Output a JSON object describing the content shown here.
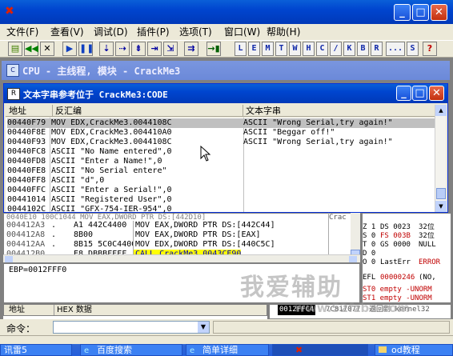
{
  "window": {
    "title_icon": "x-bug-icon"
  },
  "menu": [
    "文件(F)",
    "查看(V)",
    "调试(D)",
    "插件(P)",
    "选项(T)",
    "窗口(W)",
    "帮助(H)"
  ],
  "toolbar_letters": [
    "L",
    "E",
    "M",
    "T",
    "W",
    "H",
    "C",
    "/",
    "K",
    "B",
    "R",
    "...",
    "S"
  ],
  "cpu": {
    "title": "CPU - 主线程, 模块 - CrackMe3"
  },
  "strings_window": {
    "title": "文本字串参考位于 CrackMe3:CODE",
    "headers": [
      "地址",
      "反汇编",
      "文本字串"
    ],
    "rows": [
      [
        "00440F79",
        "MOV EDX,CrackMe3.0044108C",
        "ASCII \"Wrong Serial,try again!\""
      ],
      [
        "00440F8E",
        "MOV EDX,CrackMe3.004410A0",
        "ASCII \"Beggar off!\""
      ],
      [
        "00440F93",
        "MOV EDX,CrackMe3.0044108C",
        "ASCII \"Wrong Serial,try again!\""
      ],
      [
        "00440FC8",
        "ASCII \"No Name entered\",0",
        ""
      ],
      [
        "00440FD8",
        "ASCII \"Enter a Name!\",0",
        ""
      ],
      [
        "00440FE8",
        "ASCII \"No Serial entere\"",
        ""
      ],
      [
        "00440FF8",
        "ASCII \"d\",0",
        ""
      ],
      [
        "00440FFC",
        "ASCII \"Enter a Serial!\",0",
        ""
      ],
      [
        "00441014",
        "ASCII \"Registered User\",0",
        ""
      ],
      [
        "0044102C",
        "ASCII \"GFX-754-IER-954\",0",
        ""
      ]
    ]
  },
  "disasm": {
    "partial_top": "0040E10  100C1044  MOV EAX,DWORD PTR DS:[442D10]",
    "rows": [
      [
        "004412A3",
        ".",
        "A1 442C4400",
        "MOV EAX,DWORD PTR DS:[442C44]"
      ],
      [
        "004412A8",
        ".",
        "8B00",
        "MOV EAX,DWORD PTR DS:[EAX]"
      ],
      [
        "004412AA",
        ".",
        "8B15 5C0C4400",
        "MOV EDX,DWORD PTR DS:[440C5C]"
      ],
      [
        "004412B0",
        ".",
        "E8 DBBBFFFF",
        "CALL CrackMe3.0043CE90"
      ]
    ],
    "info": "EBP=0012FFF0",
    "side_partial": [
      "Crac",
      "Crac"
    ]
  },
  "registers": {
    "rows": [
      [
        "Z 1",
        "DS 0023",
        "32位"
      ],
      [
        "S 0",
        "FS 003B",
        "32位"
      ],
      [
        "T 0",
        "GS 0000",
        "NULL"
      ],
      [
        "D 0",
        "",
        ""
      ],
      [
        "O 0",
        "LastErr",
        "ERROR"
      ]
    ],
    "efl_label": "EFL",
    "efl_value": "00000246",
    "efl_flags": "(NO,",
    "st0": "ST0 empty -UNORM",
    "st1": "ST1 empty -UNORM"
  },
  "dump": {
    "header_addr": "地址",
    "header_hex": "HEX 数据"
  },
  "stack": {
    "highlight": "0012FFC4",
    "value": "7C817077",
    "comment": "返回到 kernel32"
  },
  "command": {
    "label": "命令：",
    "value": ""
  },
  "taskbar": [
    {
      "label": "讯雷5"
    },
    {
      "label": "百度搜索"
    },
    {
      "label": "简单详细"
    },
    {
      "label": ""
    },
    {
      "label": "od教程"
    }
  ],
  "watermark": {
    "text": "我爱辅助",
    "url": "www.52fzba.com"
  },
  "colors": {
    "accent": "#0a246a",
    "highlight_yellow": "#ffff00",
    "error_red": "#c00000"
  }
}
